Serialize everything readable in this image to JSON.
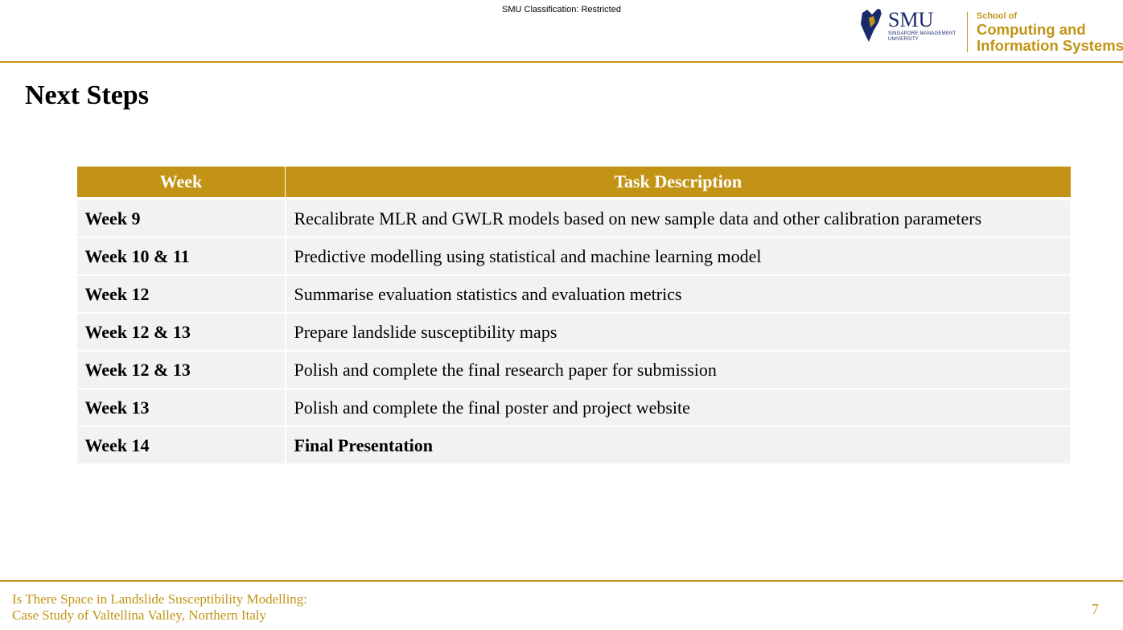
{
  "header": {
    "classification": "SMU Classification: Restricted",
    "logo": {
      "smu": "SMU",
      "smu_subtitle_line1": "SINGAPORE MANAGEMENT",
      "smu_subtitle_line2": "UNIVERSITY",
      "school_of": "School of",
      "school_line1": "Computing and",
      "school_line2": "Information Systems"
    }
  },
  "colors": {
    "accent": "#c29314",
    "row_bg": "#f2f2f2",
    "smu_blue": "#1b2a6b"
  },
  "slide": {
    "title": "Next Steps",
    "table": {
      "headers": [
        "Week",
        "Task Description"
      ],
      "rows": [
        {
          "week": "Week 9",
          "task": "Recalibrate MLR and GWLR models based on new sample data and other calibration parameters"
        },
        {
          "week": "Week 10 & 11",
          "task": "Predictive modelling using statistical and machine learning model"
        },
        {
          "week": "Week 12",
          "task": "Summarise evaluation statistics and evaluation metrics"
        },
        {
          "week": "Week 12 & 13",
          "task": "Prepare landslide susceptibility maps"
        },
        {
          "week": "Week 12 & 13",
          "task": "Polish and complete the final research paper for submission"
        },
        {
          "week": "Week 13",
          "task": "Polish and complete the final poster and project website"
        },
        {
          "week": "Week 14",
          "task": "Final Presentation"
        }
      ]
    }
  },
  "footer": {
    "title_line1": "Is There Space in Landslide Susceptibility Modelling:",
    "title_line2": "Case Study of Valtellina Valley, Northern Italy",
    "page_number": "7"
  }
}
